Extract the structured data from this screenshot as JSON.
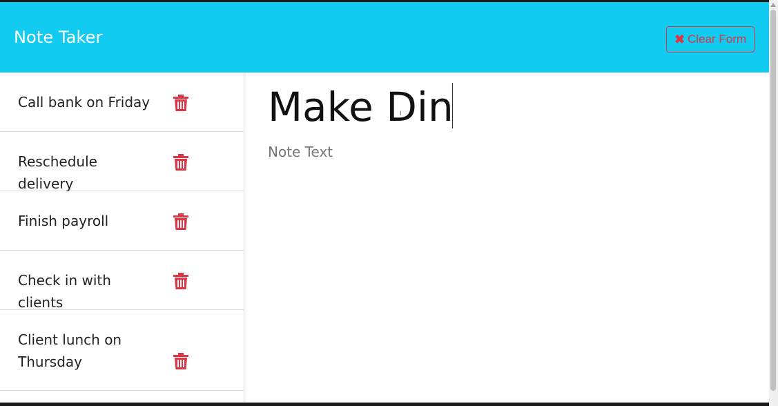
{
  "app": {
    "brand": "Note Taker",
    "clear_form": {
      "icon": "close-icon",
      "label": "Clear Form"
    }
  },
  "notes": [
    {
      "title": "Call bank on Friday",
      "delete_icon": "trash-icon"
    },
    {
      "title": "Reschedule delivery",
      "delete_icon": "trash-icon"
    },
    {
      "title": "Finish payroll",
      "delete_icon": "trash-icon"
    },
    {
      "title": "Check in with clients",
      "delete_icon": "trash-icon"
    },
    {
      "title": "Client lunch on Thursday",
      "delete_icon": "trash-icon"
    }
  ],
  "editor": {
    "title_value": "Make Din",
    "text_value": "",
    "text_placeholder": "Note Text"
  },
  "colors": {
    "navbar": "#11cbf0",
    "danger": "#dc3545"
  }
}
